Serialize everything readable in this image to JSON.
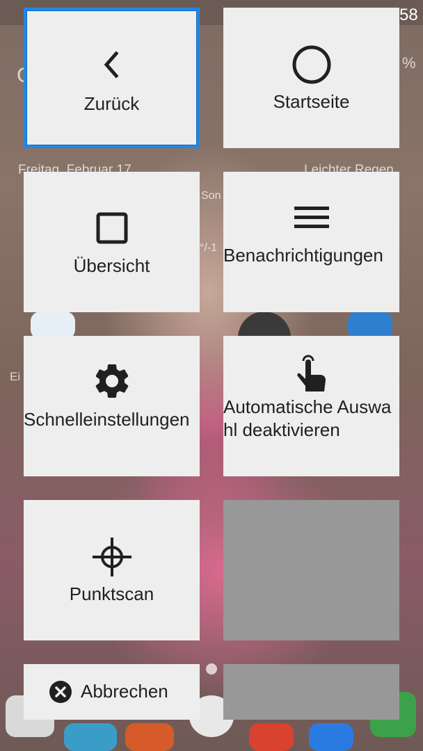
{
  "background": {
    "status_time_partial": "58",
    "battery_partial": "%",
    "date": "Freitag, Februar 17",
    "weather": "Leichter Regen",
    "sonne_partial": "Son",
    "temp_partial": "°/-1",
    "left_partial": "Ei"
  },
  "menu": {
    "tiles": [
      {
        "label": "Zurück",
        "icon": "chevron-left-icon",
        "selected": true
      },
      {
        "label": "Startseite",
        "icon": "circle-icon",
        "selected": false
      },
      {
        "label": "Übersicht",
        "icon": "square-icon",
        "selected": false
      },
      {
        "label": "Benachrichtigungen",
        "icon": "menu-lines-icon",
        "selected": false
      },
      {
        "label": "Schnelleinstellungen",
        "icon": "gear-icon",
        "selected": false
      },
      {
        "label": "Automatische Auswahl deaktivieren",
        "icon": "touch-hand-icon",
        "selected": false
      },
      {
        "label": "Punktscan",
        "icon": "crosshair-icon",
        "selected": false
      },
      {
        "label": "",
        "icon": "",
        "selected": false
      }
    ],
    "cancel_label": "Abbrechen"
  },
  "colors": {
    "tile_background": "#eeeeee",
    "empty_tile": "#989898",
    "selection_border": "#1e88e5"
  }
}
